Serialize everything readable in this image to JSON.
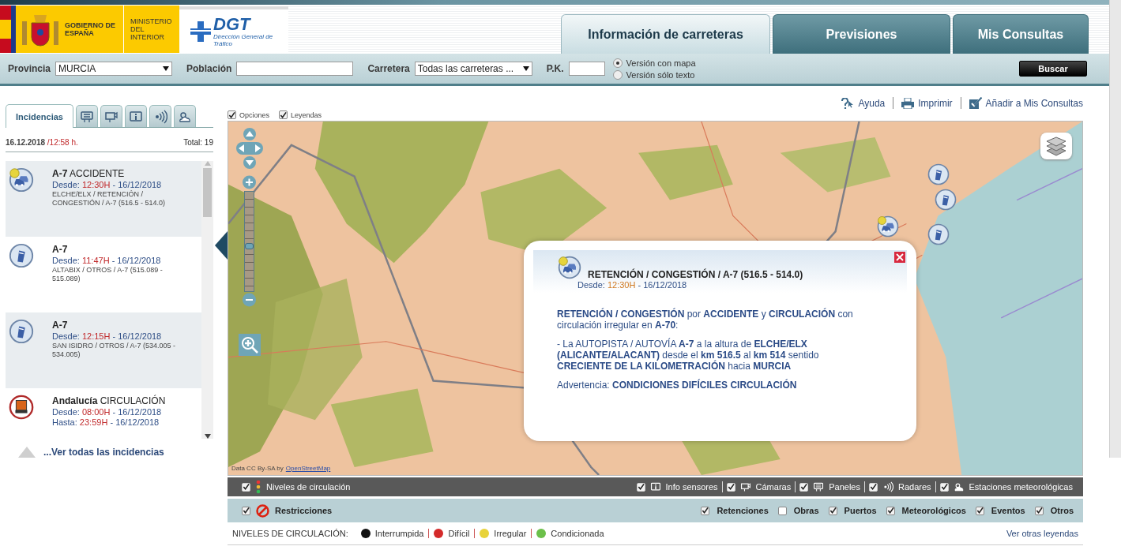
{
  "government_logo": {
    "name": "GOBIERNO DE ESPAÑA",
    "ministry": "MINISTERIO DEL INTERIOR"
  },
  "dgt_logo": {
    "acronym": "DGT",
    "subtitle": "Dirección General de Tráfico"
  },
  "nav_tabs": [
    {
      "label": "Información de carreteras",
      "selected": true
    },
    {
      "label": "Previsiones",
      "selected": false
    },
    {
      "label": "Mis Consultas",
      "selected": false
    }
  ],
  "search": {
    "fields": [
      {
        "kind": "select",
        "label": "Provincia",
        "value": "MURCIA"
      },
      {
        "kind": "input",
        "label": "Población"
      },
      {
        "kind": "select",
        "label": "Carretera",
        "value": "Todas las carreteras ..."
      },
      {
        "kind": "input",
        "label": "P.K."
      }
    ],
    "versions": [
      {
        "label": "Versión con mapa",
        "selected": true
      },
      {
        "label": "Versión sólo texto",
        "selected": false
      }
    ],
    "button": "Buscar"
  },
  "sidebar": {
    "tabs": [
      {
        "kind": "text",
        "label": "Incidencias",
        "selected": true
      },
      {
        "kind": "panel",
        "selected": false
      },
      {
        "kind": "camera",
        "selected": false
      },
      {
        "kind": "sensor",
        "selected": false
      },
      {
        "kind": "radar",
        "selected": false
      },
      {
        "kind": "weather",
        "selected": false
      }
    ],
    "date": "16.12.2018",
    "time": "/12:58 h.",
    "total": "Total: 19",
    "incidents": [
      {
        "kind": "jam",
        "road": "A-7",
        "type": "ACCIDENTE",
        "times": [
          {
            "label": "Desde:",
            "time": "12:30H",
            "date": "- 16/12/2018"
          }
        ],
        "detail": "ELCHE/ELX / RETENCIÓN / CONGESTIÓN / A-7 (516.5 - 514.0)"
      },
      {
        "kind": "other",
        "road": "A-7",
        "times": [
          {
            "label": "Desde:",
            "time": "11:47H",
            "date": "- 16/12/2018"
          }
        ],
        "detail": "ALTABIX / OTROS / A-7 (515.089 - 515.089)"
      },
      {
        "kind": "other",
        "road": "A-7",
        "times": [
          {
            "label": "Desde:",
            "time": "12:15H",
            "date": "- 16/12/2018"
          }
        ],
        "detail": "SAN ISIDRO / OTROS / A-7 (534.005 - 534.005)"
      },
      {
        "kind": "restriction",
        "road": "Andalucía",
        "type": "CIRCULACIÓN",
        "times": [
          {
            "label": "Desde:",
            "time": "08:00H",
            "date": "- 16/12/2018"
          },
          {
            "label": "Hasta:",
            "time": "23:59H",
            "date": "- 16/12/2018"
          }
        ]
      }
    ],
    "more_link": "...Ver todas las incidencias"
  },
  "options": [
    {
      "label": "Opciones",
      "checked": true
    },
    {
      "label": "Leyendas",
      "checked": true
    }
  ],
  "links": [
    {
      "kind": "help",
      "label": "Ayuda"
    },
    {
      "kind": "print",
      "label": "Imprimir"
    },
    {
      "kind": "add",
      "label": "Añadir a Mis Consultas"
    }
  ],
  "map": {
    "zoom": {
      "level": 0.47
    },
    "markers": [
      {
        "kind": "other"
      },
      {
        "kind": "other"
      },
      {
        "kind": "jam"
      },
      {
        "kind": "other"
      }
    ],
    "attribution": {
      "text": "Data CC By-SA by",
      "link": "OpenStreetMap"
    },
    "popup": {
      "kind": "jam",
      "title": "RETENCIÓN / CONGESTIÓN / A-7 (516.5 - 514.0)",
      "since": {
        "label": "Desde:",
        "time": "12:30H",
        "date": "- 16/12/2018"
      },
      "paragraphs": [
        "**RETENCIÓN / CONGESTIÓN** por **ACCIDENTE** y **CIRCULACIÓN** con circulación irregular en **A-70**:",
        "- La AUTOPISTA / AUTOVÍA **A-7** a la altura de **ELCHE/ELX (ALICANTE/ALACANT)** desde el **km 516.5** al **km 514** sentido **CRECIENTE DE LA KILOMETRACIÓN** hacia **MURCIA**",
        "Advertencia: **CONDICIONES DIFÍCILES CIRCULACIÓN**"
      ]
    }
  },
  "layer_bar": {
    "left": {
      "kind": "levels",
      "label": "Niveles de circulación",
      "checked": true
    },
    "right": [
      {
        "kind": "sensor",
        "label": "Info sensores",
        "checked": true
      },
      {
        "kind": "camera",
        "label": "Cámaras",
        "checked": true
      },
      {
        "kind": "panel",
        "label": "Paneles",
        "checked": true
      },
      {
        "kind": "radar",
        "label": "Radares",
        "checked": true
      },
      {
        "kind": "weather",
        "label": "Estaciones meteorológicas",
        "checked": true
      }
    ]
  },
  "filter_bar": {
    "left": {
      "kind": "restriction",
      "label": "Restricciones",
      "checked": true
    },
    "right": [
      {
        "label": "Retenciones",
        "checked": true
      },
      {
        "label": "Obras",
        "checked": false
      },
      {
        "label": "Puertos",
        "checked": true
      },
      {
        "label": "Meteorológicos",
        "checked": true
      },
      {
        "label": "Eventos",
        "checked": true
      },
      {
        "label": "Otros",
        "checked": true
      }
    ]
  },
  "legend": {
    "title": "NIVELES DE CIRCULACIÓN:",
    "items": [
      {
        "label": "Interrumpida",
        "color": "#111111"
      },
      {
        "label": "Difícil",
        "color": "#d42a2a"
      },
      {
        "label": "Irregular",
        "color": "#e8d33a"
      },
      {
        "label": "Condicionada",
        "color": "#6cc04a"
      }
    ],
    "link": "Ver otras leyendas"
  }
}
